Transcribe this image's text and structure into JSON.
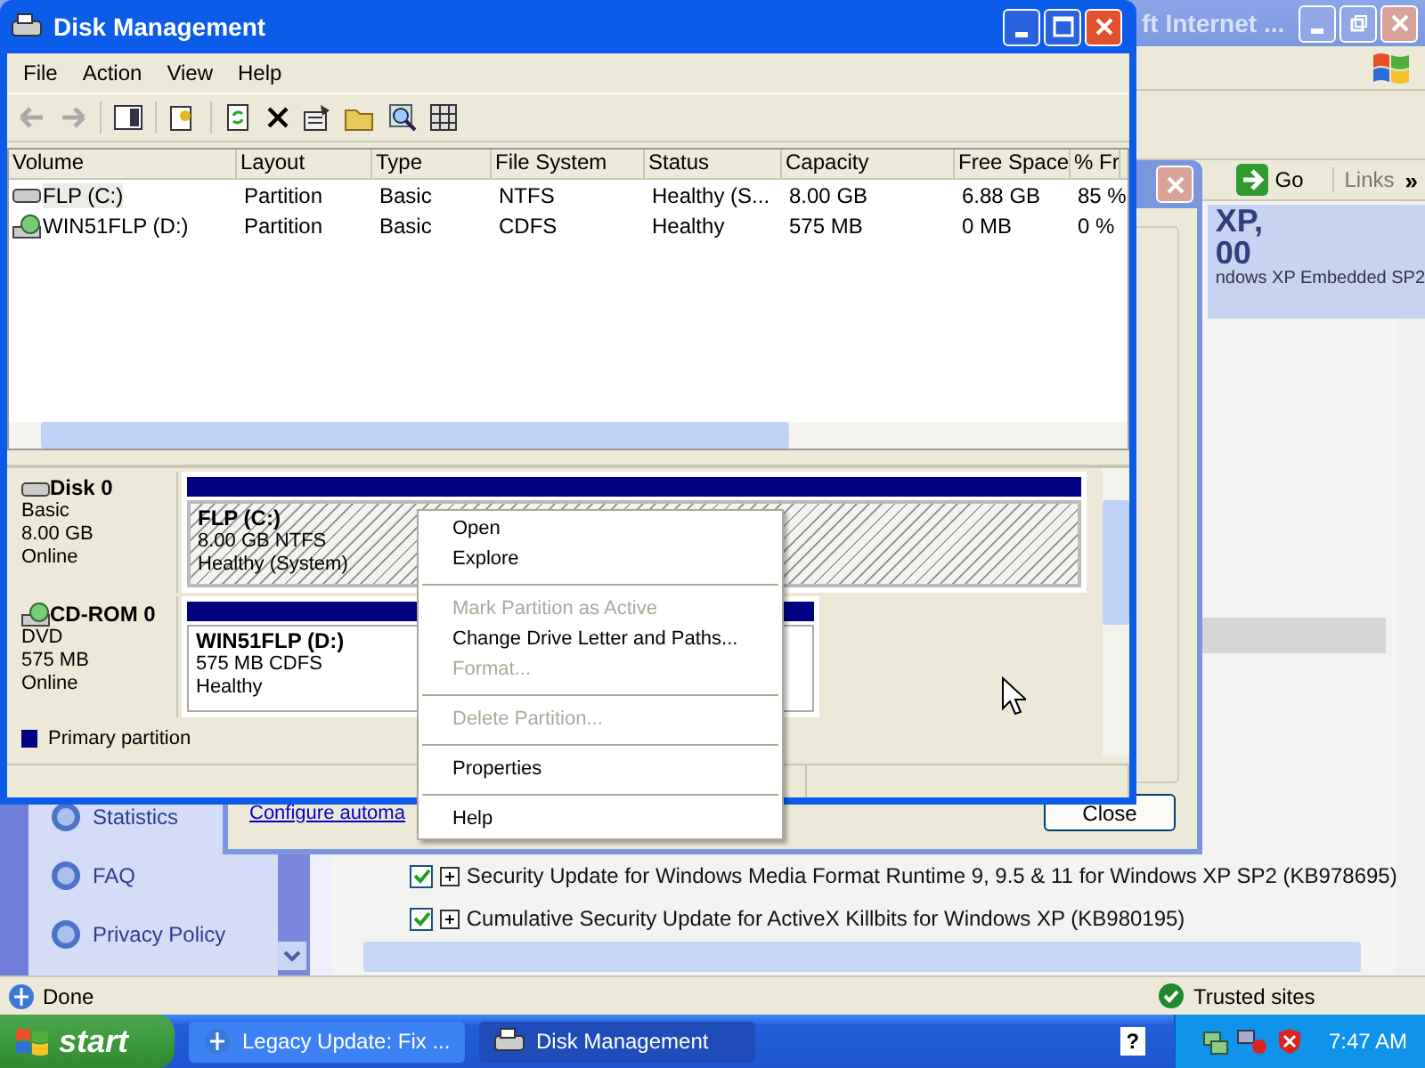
{
  "browser_window": {
    "title": "ft Internet ...",
    "address_bar": {
      "go_button": "Go",
      "links": "Links",
      "chevron": "»"
    },
    "banner": {
      "lines": [
        "XP,",
        "00",
        "ndows XP Embedded SP2"
      ]
    },
    "sidebar": {
      "items": [
        {
          "label": "Statistics"
        },
        {
          "label": "FAQ"
        },
        {
          "label": "Privacy Policy"
        }
      ]
    },
    "updates": [
      {
        "label": "Security Update for Windows Media Format Runtime 9, 9.5 & 11 for Windows XP SP2 (KB978695)",
        "checked": true
      },
      {
        "label": "Cumulative Security Update for ActiveX Killbits for Windows XP (KB980195)",
        "checked": true
      }
    ],
    "status_bar": {
      "text": "Done",
      "zone": "Trusted sites"
    }
  },
  "dialog": {
    "link": "Configure automa",
    "close_button": "Close"
  },
  "disk_management": {
    "title": "Disk Management",
    "menu": [
      "File",
      "Action",
      "View",
      "Help"
    ],
    "volumes": {
      "columns": [
        "Volume",
        "Layout",
        "Type",
        "File System",
        "Status",
        "Capacity",
        "Free Space",
        "% Fr"
      ],
      "rows": [
        {
          "kind": "hdd",
          "selected": true,
          "cells": [
            "FLP (C:)",
            "Partition",
            "Basic",
            "NTFS",
            "Healthy (S...",
            "8.00 GB",
            "6.88 GB",
            "85 %"
          ]
        },
        {
          "kind": "cdrom",
          "selected": false,
          "cells": [
            "WIN51FLP (D:)",
            "Partition",
            "Basic",
            "CDFS",
            "Healthy",
            "575 MB",
            "0 MB",
            "0 %"
          ]
        }
      ]
    },
    "disks": [
      {
        "kind": "hdd",
        "name": "Disk 0",
        "lines": [
          "Basic",
          "8.00 GB",
          "Online"
        ],
        "partition": {
          "name": "FLP  (C:)",
          "lines": [
            "8.00 GB NTFS",
            "Healthy (System)"
          ],
          "selected": true
        }
      },
      {
        "kind": "cdrom",
        "name": "CD-ROM 0",
        "lines": [
          "DVD",
          "575 MB",
          "Online"
        ],
        "partition": {
          "name": "WIN51FLP  (D:)",
          "lines": [
            "575 MB CDFS",
            "Healthy"
          ],
          "selected": false
        }
      }
    ],
    "legend": "Primary partition"
  },
  "context_menu": [
    {
      "kind": "item",
      "label": "Open",
      "disabled": false
    },
    {
      "kind": "item",
      "label": "Explore",
      "disabled": false
    },
    {
      "kind": "separator"
    },
    {
      "kind": "item",
      "label": "Mark Partition as Active",
      "disabled": true
    },
    {
      "kind": "item",
      "label": "Change Drive Letter and Paths...",
      "disabled": false
    },
    {
      "kind": "item",
      "label": "Format...",
      "disabled": true
    },
    {
      "kind": "separator"
    },
    {
      "kind": "item",
      "label": "Delete Partition...",
      "disabled": true
    },
    {
      "kind": "separator"
    },
    {
      "kind": "item",
      "label": "Properties",
      "disabled": false
    },
    {
      "kind": "separator"
    },
    {
      "kind": "item",
      "label": "Help",
      "disabled": false
    }
  ],
  "taskbar": {
    "start": "start",
    "tasks": [
      {
        "label": "Legacy Update: Fix ...",
        "selected": false
      },
      {
        "label": "Disk Management",
        "selected": true
      }
    ],
    "help_icon": "?",
    "clock": "7:47 AM"
  }
}
